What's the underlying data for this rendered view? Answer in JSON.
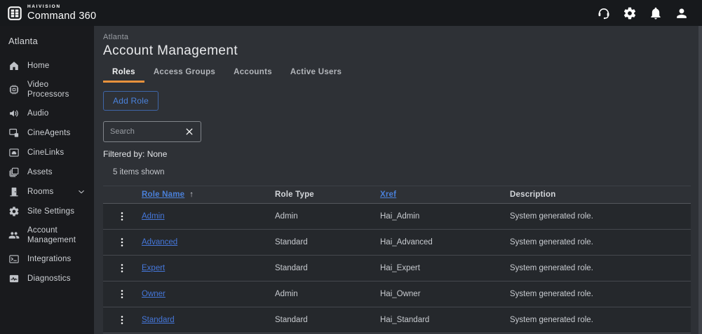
{
  "colors": {
    "accent_orange": "#E8923C",
    "link_blue": "#4A80D9",
    "topbar_bg": "#17191C",
    "sidebar_bg": "#191A1D",
    "main_bg": "#2E3136",
    "row_bg": "#25282C"
  },
  "topbar": {
    "brand_top": "HAIVISION",
    "brand_bottom": "Command 360",
    "actions": [
      {
        "icon": "support-icon"
      },
      {
        "icon": "settings-icon"
      },
      {
        "icon": "notifications-icon"
      },
      {
        "icon": "user-icon"
      }
    ]
  },
  "sidebar": {
    "site_label": "Atlanta",
    "items": [
      {
        "label": "Home",
        "icon": "home-icon"
      },
      {
        "label": "Video Processors",
        "icon": "video-processors-icon"
      },
      {
        "label": "Audio",
        "icon": "audio-icon"
      },
      {
        "label": "CineAgents",
        "icon": "cineagents-icon"
      },
      {
        "label": "CineLinks",
        "icon": "cinelinks-icon"
      },
      {
        "label": "Assets",
        "icon": "assets-icon"
      },
      {
        "label": "Rooms",
        "icon": "rooms-icon",
        "expandable": true
      },
      {
        "label": "Site Settings",
        "icon": "site-settings-icon"
      },
      {
        "label": "Account Management",
        "icon": "account-management-icon"
      },
      {
        "label": "Integrations",
        "icon": "integrations-icon"
      },
      {
        "label": "Diagnostics",
        "icon": "diagnostics-icon"
      }
    ]
  },
  "main": {
    "breadcrumb": "Atlanta",
    "title": "Account Management",
    "tabs": [
      {
        "label": "Roles",
        "active": true
      },
      {
        "label": "Access Groups",
        "active": false
      },
      {
        "label": "Accounts",
        "active": false
      },
      {
        "label": "Active Users",
        "active": false
      }
    ],
    "add_role_label": "Add Role",
    "search_placeholder": "Search",
    "filtered_by": "Filtered by: None",
    "items_shown": "5 items shown",
    "table": {
      "columns": [
        {
          "label": "Role Name",
          "sortable": true,
          "sort": "asc"
        },
        {
          "label": "Role Type",
          "sortable": false
        },
        {
          "label": "Xref",
          "sortable": true
        },
        {
          "label": "Description",
          "sortable": false
        }
      ],
      "sort_asc_glyph": "↑",
      "rows": [
        {
          "role_name": "Admin",
          "role_type": "Admin",
          "xref": "Hai_Admin",
          "description": "System generated role."
        },
        {
          "role_name": "Advanced",
          "role_type": "Standard",
          "xref": "Hai_Advanced",
          "description": "System generated role."
        },
        {
          "role_name": "Expert",
          "role_type": "Standard",
          "xref": "Hai_Expert",
          "description": "System generated role."
        },
        {
          "role_name": "Owner",
          "role_type": "Admin",
          "xref": "Hai_Owner",
          "description": "System generated role."
        },
        {
          "role_name": "Standard",
          "role_type": "Standard",
          "xref": "Hai_Standard",
          "description": "System generated role."
        }
      ]
    }
  }
}
